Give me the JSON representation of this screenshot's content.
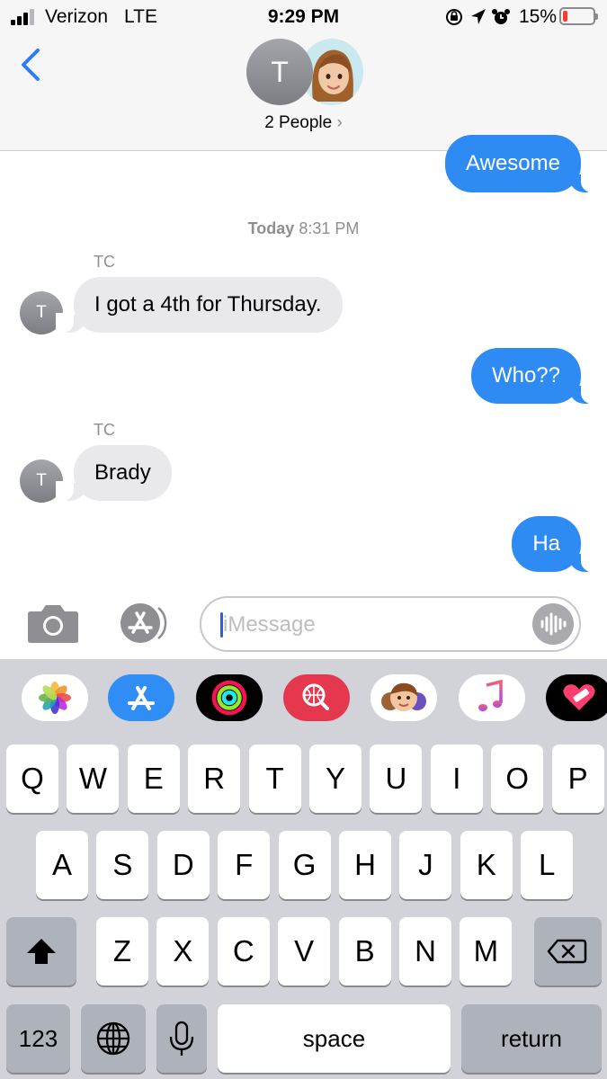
{
  "status_bar": {
    "carrier": "Verizon",
    "network": "LTE",
    "time": "9:29 PM",
    "battery_percent": "15%",
    "battery_level": 0.15,
    "icons": [
      "orientation-lock-icon",
      "location-arrow-icon",
      "alarm-icon"
    ]
  },
  "header": {
    "contact_initial": "T",
    "participants_label": "2 People",
    "chevron": "›"
  },
  "messages": {
    "awesome": "Awesome",
    "timestamp_day": "Today",
    "timestamp_time": "8:31 PM",
    "msg1_sender": "TC",
    "msg1_initial": "T",
    "msg1_text": "I got a 4th for Thursday.",
    "msg2_text": "Who??",
    "msg3_sender": "TC",
    "msg3_initial": "T",
    "msg3_text": "Brady",
    "msg4_text": "Ha"
  },
  "compose": {
    "placeholder": "iMessage"
  },
  "app_strip": {
    "apps": [
      "photos-icon",
      "app-store-icon",
      "activity-icon",
      "gif-search-icon",
      "memoji-icon",
      "music-icon",
      "heart-sticker-icon"
    ]
  },
  "keyboard": {
    "row1": [
      "Q",
      "W",
      "E",
      "R",
      "T",
      "Y",
      "U",
      "I",
      "O",
      "P"
    ],
    "row2": [
      "A",
      "S",
      "D",
      "F",
      "G",
      "H",
      "J",
      "K",
      "L"
    ],
    "row3": [
      "Z",
      "X",
      "C",
      "V",
      "B",
      "N",
      "M"
    ],
    "numbers_label": "123",
    "space_label": "space",
    "return_label": "return"
  },
  "colors": {
    "outgoing_bubble": "#2e8bf4",
    "incoming_bubble": "#e9e9eb",
    "keyboard_bg": "#d1d3d9"
  }
}
